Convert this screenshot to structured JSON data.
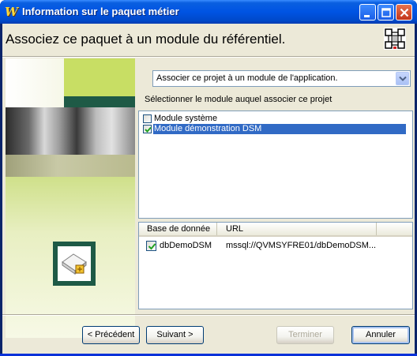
{
  "window": {
    "title": "Information sur le paquet métier",
    "app_icon_glyph": "W"
  },
  "header": {
    "title": "Associez ce paquet à un module du référentiel."
  },
  "association_select": {
    "selected": "Associer ce projet à un module de l'application."
  },
  "module_section": {
    "label": "Sélectionner le module auquel associer ce projet",
    "modules": [
      {
        "label": "Module système",
        "checked": false,
        "selected": false
      },
      {
        "label": "Module démonstration DSM",
        "checked": true,
        "selected": true
      }
    ]
  },
  "database_table": {
    "columns": [
      "Base de donnée",
      "URL"
    ],
    "rows": [
      {
        "checked": true,
        "name": "dbDemoDSM",
        "url": "mssql://QVMSYFRE01/dbDemoDSM..."
      }
    ]
  },
  "buttons": {
    "previous": "< Précédent",
    "next": "Suivant >",
    "finish": "Terminer",
    "cancel": "Annuler"
  },
  "colors": {
    "titlebar": "#0054e3",
    "selection": "#316ac5",
    "dialog_bg": "#ece9d8",
    "panel_green": "#1e5a46"
  }
}
